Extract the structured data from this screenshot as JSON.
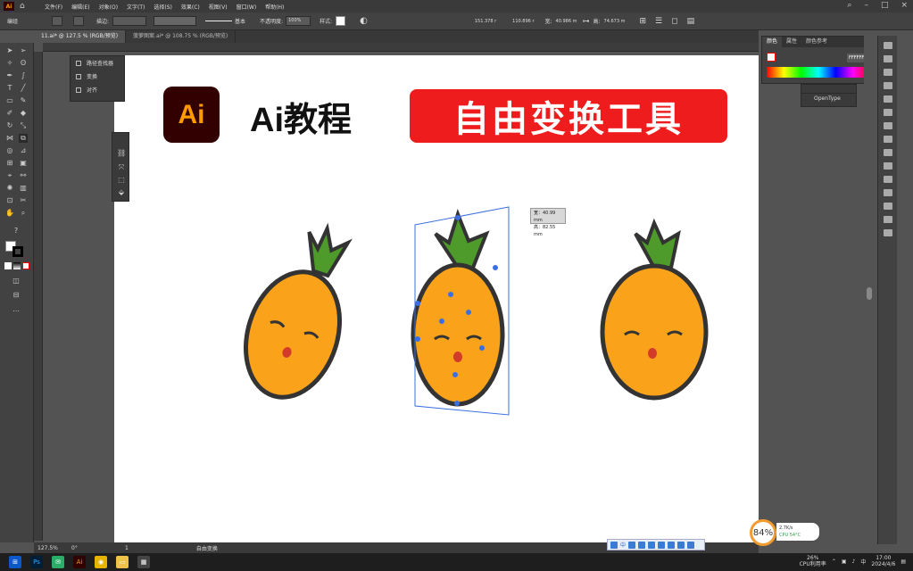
{
  "app": {
    "logo_text": "Ai"
  },
  "menu": [
    "文件(F)",
    "编辑(E)",
    "对象(O)",
    "文字(T)",
    "选择(S)",
    "效果(C)",
    "视图(V)",
    "窗口(W)",
    "帮助(H)"
  ],
  "control_bar": {
    "label": "编组",
    "stroke_label": "描边:",
    "brush_label": "基本",
    "opacity_label": "不透明度:",
    "opacity_value": "100%",
    "style_label": "样式:",
    "x_value": "151.378 r",
    "y_value": "110.896 r",
    "w_label": "宽:",
    "w_value": "40.986 m",
    "h_label": "高:",
    "h_value": "74.673 m"
  },
  "tabs": [
    {
      "label": "11.ai* @ 127.5 % (RGB/预览)",
      "active": true
    },
    {
      "label": "菠萝图案.ai* @ 108.75 % (RGB/预览)",
      "active": false
    }
  ],
  "flyout": {
    "items": [
      "路径查找器",
      "变换",
      "对齐"
    ]
  },
  "artboard": {
    "logo_text": "Ai",
    "title": "Ai教程",
    "banner": "自由变换工具",
    "tooltip": {
      "w": "宽：40.99 mm",
      "h": "高：82.55 mm"
    }
  },
  "color_panel": {
    "tabs": [
      "颜色",
      "属性",
      "颜色参考"
    ],
    "hex_value": "FFFFFF"
  },
  "opentype_panel": {
    "label": "OpenType"
  },
  "status_bar": {
    "zoom": "127.5%",
    "rotation": "0°",
    "artboard_num": "1",
    "tool": "自由变换"
  },
  "overlay": {
    "cpu_percent": "84",
    "net_speed": "2.7K/s",
    "cpu_label": "CPU 54°C"
  },
  "taskbar": {
    "cpu_usage": "26%",
    "cpu_label": "CPU利用率",
    "time": "17:00",
    "date": "2024/4/6",
    "ime_lang": "中"
  },
  "colors": {
    "accent_red": "#ee1c1c",
    "ai_orange": "#ff9a00",
    "ai_bg": "#330000",
    "pineapple_body": "#f9a21a",
    "leaf_green": "#4e9a2a",
    "selection_blue": "#3b6fe0"
  }
}
